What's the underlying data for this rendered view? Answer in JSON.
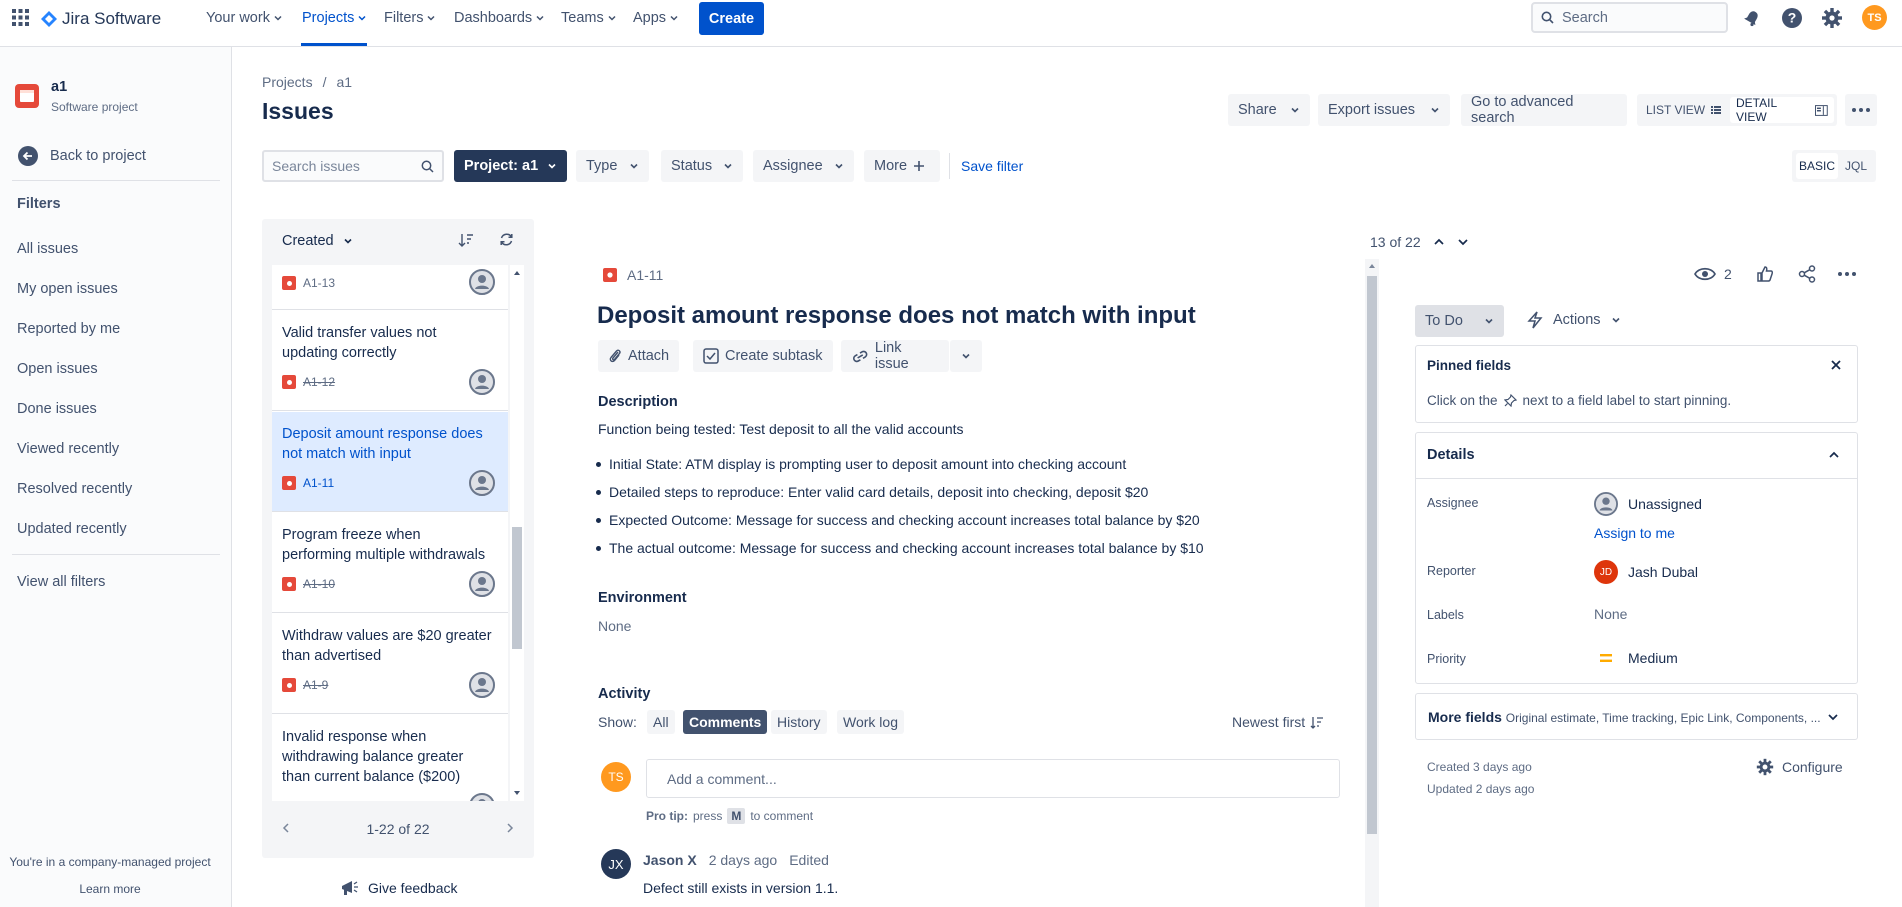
{
  "app": {
    "name": "Jira Software"
  },
  "nav": {
    "your_work": "Your work",
    "projects": "Projects",
    "filters": "Filters",
    "dashboards": "Dashboards",
    "teams": "Teams",
    "apps": "Apps",
    "create": "Create",
    "search_placeholder": "Search",
    "user_initials": "TS"
  },
  "sidebar": {
    "project_name": "a1",
    "project_type": "Software project",
    "back": "Back to project",
    "filters_heading": "Filters",
    "filters": [
      "All issues",
      "My open issues",
      "Reported by me",
      "Open issues",
      "Done issues",
      "Viewed recently",
      "Resolved recently",
      "Updated recently"
    ],
    "view_all": "View all filters",
    "footer_note": "You're in a company-managed project",
    "learn_more": "Learn more"
  },
  "header": {
    "breadcrumb_projects": "Projects",
    "breadcrumb_sep": "/",
    "breadcrumb_project": "a1",
    "title": "Issues",
    "share": "Share",
    "export": "Export issues",
    "advanced": "Go to advanced search",
    "list_view": "LIST VIEW",
    "detail_view": "DETAIL VIEW"
  },
  "filterbar": {
    "search_placeholder": "Search issues",
    "project": "Project: a1",
    "type": "Type",
    "status": "Status",
    "assignee": "Assignee",
    "more": "More",
    "save_filter": "Save filter",
    "basic": "BASIC",
    "jql": "JQL"
  },
  "list": {
    "sort_label": "Created",
    "pagination": "1-22 of 22",
    "feedback": "Give feedback",
    "issues": [
      {
        "title": "",
        "key": "A1-13",
        "done": false,
        "selected": false
      },
      {
        "title": "Valid transfer values not updating correctly",
        "key": "A1-12",
        "done": true,
        "selected": false
      },
      {
        "title": "Deposit amount response does not match with input",
        "key": "A1-11",
        "done": false,
        "selected": true
      },
      {
        "title": "Program freeze when performing multiple withdrawals",
        "key": "A1-10",
        "done": true,
        "selected": false
      },
      {
        "title": "Withdraw values are $20 greater than advertised",
        "key": "A1-9",
        "done": true,
        "selected": false
      },
      {
        "title": "Invalid response when withdrawing balance greater than current balance ($200)",
        "key": "",
        "done": false,
        "selected": false
      }
    ]
  },
  "issue": {
    "counter": "13 of 22",
    "key": "A1-11",
    "title": "Deposit amount response does not match with input",
    "attach": "Attach",
    "create_subtask": "Create subtask",
    "link_issue": "Link issue",
    "description_heading": "Description",
    "description_intro": "Function being tested: Test deposit to all the valid accounts",
    "bullets": [
      "Initial State: ATM display is prompting user to deposit amount into checking account",
      "Detailed steps to reproduce: Enter valid card details, deposit into checking, deposit $20",
      "Expected Outcome: Message for success and checking account increases total balance by $20",
      "The actual outcome: Message for success and checking account increases total balance by $10"
    ],
    "environment_heading": "Environment",
    "environment_value": "None",
    "activity_heading": "Activity",
    "show_label": "Show:",
    "activity_tabs": [
      "All",
      "Comments",
      "History",
      "Work log"
    ],
    "sort": "Newest first",
    "comment_placeholder": "Add a comment...",
    "protip_prefix": "Pro tip:",
    "protip_press": "press",
    "protip_key": "M",
    "protip_suffix": "to comment",
    "commenter_initials": "JX",
    "commenter_name": "Jason X",
    "comment_time": "2 days ago",
    "comment_edited": "Edited",
    "comment_text": "Defect still exists in version 1.1."
  },
  "sidepanel": {
    "watchers": "2",
    "status": "To Do",
    "actions": "Actions",
    "pinned_heading": "Pinned fields",
    "pinned_hint_before": "Click on the",
    "pinned_hint_after": "next to a field label to start pinning.",
    "details_heading": "Details",
    "assignee_label": "Assignee",
    "assignee_value": "Unassigned",
    "assign_to_me": "Assign to me",
    "reporter_label": "Reporter",
    "reporter_initials": "JD",
    "reporter_value": "Jash Dubal",
    "labels_label": "Labels",
    "labels_value": "None",
    "priority_label": "Priority",
    "priority_value": "Medium",
    "more_fields": "More fields",
    "more_fields_hint": "Original estimate, Time tracking, Epic Link, Components, ...",
    "created": "Created 3 days ago",
    "updated": "Updated 2 days ago",
    "configure": "Configure"
  },
  "colors": {
    "brand": "#0052cc",
    "bug": "#e5493a",
    "selected_bg": "#deebff",
    "medium_priority": "#ffab00"
  }
}
